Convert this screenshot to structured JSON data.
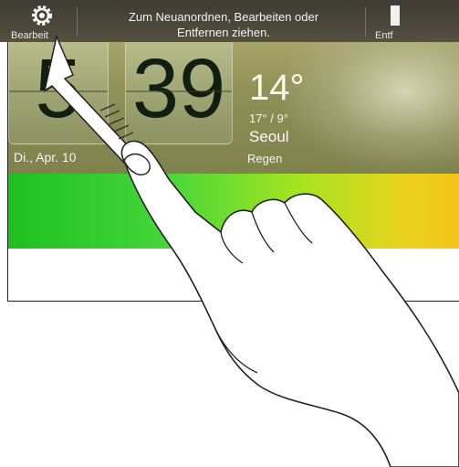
{
  "toolbar": {
    "edit_label": "Bearbeit",
    "instruction_line1": "Zum Neuanordnen, Bearbeiten oder",
    "instruction_line2": "Entfernen ziehen.",
    "remove_label": "Entf"
  },
  "clock": {
    "hour": "5",
    "minute": "39",
    "date": "Di., Apr. 10"
  },
  "weather": {
    "temperature": "14°",
    "range": "17° / 9°",
    "city": "Seoul",
    "condition": "Regen"
  },
  "icons": {
    "edit": "gear-icon",
    "remove": "trash-icon",
    "gesture": "hand-swipe-up-illustration"
  },
  "colors": {
    "toolbar": "#46423a",
    "band_start": "#1fbf1f",
    "band_end": "#f3c31b"
  }
}
